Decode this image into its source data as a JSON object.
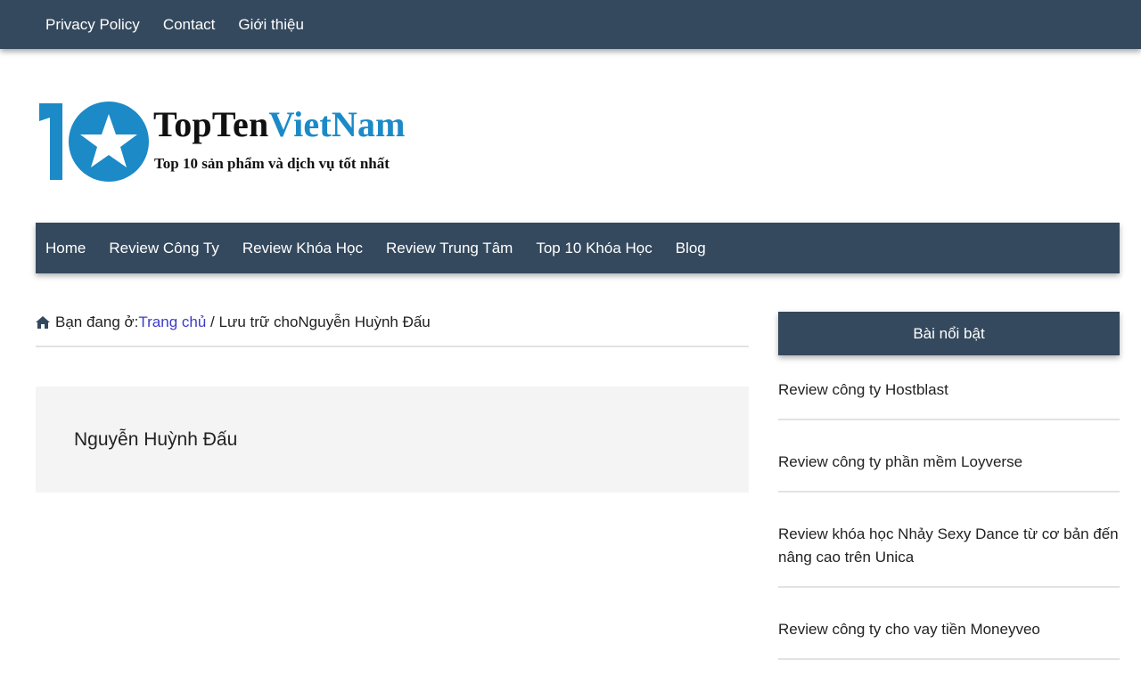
{
  "top_nav": {
    "items": [
      {
        "label": "Privacy Policy"
      },
      {
        "label": "Contact"
      },
      {
        "label": "Giới thiệu"
      }
    ]
  },
  "logo": {
    "title_part1": "TopTen",
    "title_part2": "VietNam",
    "tagline": "Top 10 sản phẩm và dịch vụ tốt nhất",
    "emblem_icon": "star-10-logo-icon",
    "colors": {
      "blue": "#1b8ac7",
      "dark": "#111111"
    }
  },
  "main_nav": {
    "items": [
      {
        "label": "Home"
      },
      {
        "label": "Review Công Ty"
      },
      {
        "label": "Review Khóa Học"
      },
      {
        "label": "Review Trung Tâm"
      },
      {
        "label": "Top 10 Khóa Học"
      },
      {
        "label": "Blog"
      }
    ]
  },
  "breadcrumb": {
    "icon": "home-icon",
    "prefix": "Bạn đang ở:",
    "home_link": "Trang chủ",
    "separator": " / ",
    "current": "Lưu trữ choNguyễn Huỳnh Đấu"
  },
  "archive": {
    "title": "Nguyễn Huỳnh Đấu"
  },
  "sidebar": {
    "widget_title": "Bài nổi bật",
    "posts": [
      {
        "title": "Review công ty Hostblast"
      },
      {
        "title": "Review công ty phần mềm Loyverse"
      },
      {
        "title": "Review khóa học Nhảy Sexy Dance từ cơ bản đến nâng cao trên Unica"
      },
      {
        "title": "Review công ty cho vay tiền Moneyveo"
      }
    ]
  },
  "colors": {
    "nav_bg": "#34495e",
    "link": "#3c3cc9",
    "archive_bg": "#f4f4f4"
  }
}
